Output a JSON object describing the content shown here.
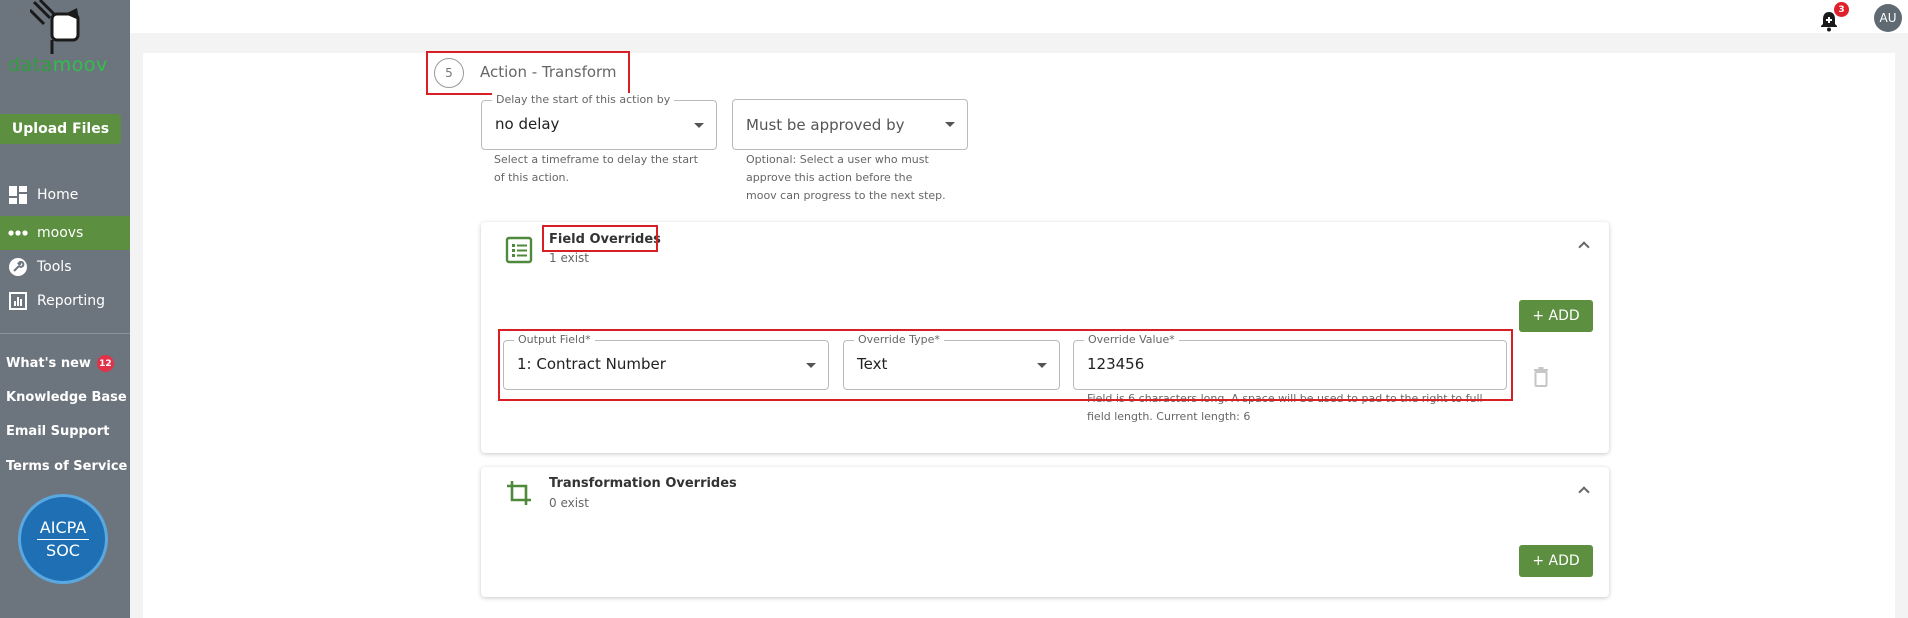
{
  "app": {
    "logo_part1": "data",
    "logo_part2": "moov"
  },
  "sidebar": {
    "upload_label": "Upload Files",
    "items": [
      {
        "label": "Home",
        "icon": "home-grid-icon"
      },
      {
        "label": "moovs",
        "icon": "moovs-dots-icon",
        "active": true
      },
      {
        "label": "Tools",
        "icon": "wrench-icon"
      },
      {
        "label": "Reporting",
        "icon": "chart-icon"
      }
    ],
    "links": [
      {
        "label": "What's new",
        "badge": "12"
      },
      {
        "label": "Knowledge Base"
      },
      {
        "label": "Email Support"
      },
      {
        "label": "Terms of Service"
      }
    ],
    "aicpa": {
      "line1": "AICPA",
      "line2": "SOC"
    }
  },
  "topbar": {
    "notification_count": "3",
    "avatar_initials": "AU"
  },
  "step": {
    "number": "5",
    "title": "Action - Transform"
  },
  "delay": {
    "label": "Delay the start of this action by",
    "value": "no delay",
    "helper": "Select a timeframe to delay the start of this action."
  },
  "approval": {
    "placeholder": "Must be approved by",
    "helper": "Optional: Select a user who must approve this action before the moov can progress to the next step."
  },
  "field_overrides": {
    "title": "Field Overrides",
    "count": "1 exist",
    "add_label": "+ ADD",
    "row": {
      "output_field_label": "Output Field*",
      "output_field_value": "1: Contract Number",
      "override_type_label": "Override Type*",
      "override_type_value": "Text",
      "override_value_label": "Override Value*",
      "override_value_value": "123456",
      "helper": "Field is 6 characters long. A space will be used to pad to the right to full field length. Current length: 6"
    }
  },
  "transformation_overrides": {
    "title": "Transformation Overrides",
    "count": "0 exist",
    "add_label": "+ ADD"
  },
  "colors": {
    "sidebar": "#6c757d",
    "accent_green": "#5c8f3f",
    "highlight_red": "#d81f26"
  }
}
